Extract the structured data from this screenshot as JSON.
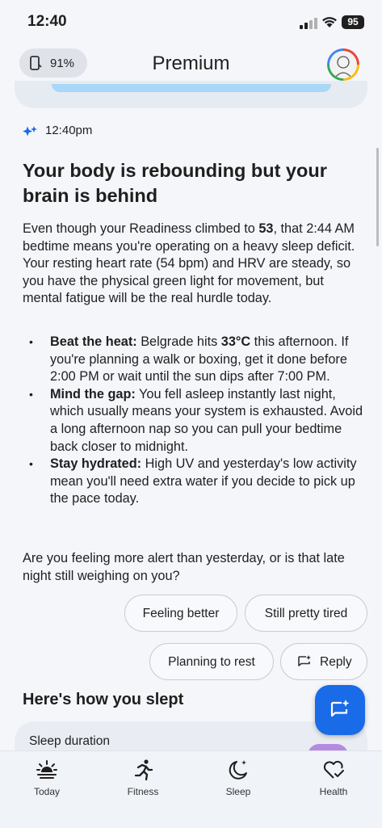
{
  "status_bar": {
    "time": "12:40",
    "battery": "95"
  },
  "header": {
    "battery_pct": "91%",
    "title": "Premium"
  },
  "message": {
    "time": "12:40pm",
    "headline": "Your body is rebounding but your brain is behind",
    "para_part1": "Even though your Readiness climbed to ",
    "readiness": "53",
    "para_part2": ", that 2:44 AM bedtime means you're operating on a heavy sleep deficit. Your resting heart rate (54 bpm) and HRV are steady, so you have the physical green light for movement, but mental fatigue will be the real hurdle today.",
    "bullets": [
      {
        "title": "Beat the heat:",
        "text_a": " Belgrade hits ",
        "highlight": "33°C",
        "text_b": " this afternoon. If you're planning a walk or boxing, get it done before 2:00 PM or wait until the sun dips after 7:00 PM."
      },
      {
        "title": "Mind the gap:",
        "text_a": " You fell asleep instantly last night, which usually means your system is exhausted. Avoid a long afternoon nap so you can pull your bedtime back closer to midnight."
      },
      {
        "title": "Stay hydrated:",
        "text_a": " High UV and yesterday's low activity mean you'll need extra water if you decide to pick up the pace today."
      }
    ],
    "question": "Are you feeling more alert than yesterday, or is that late night still weighing on you?"
  },
  "chips": [
    "Feeling better",
    "Still pretty tired",
    "Planning to rest",
    "Reply"
  ],
  "section": {
    "title": "Here's how you slept",
    "card_label": "Sleep duration"
  },
  "nav": [
    "Today",
    "Fitness",
    "Sleep",
    "Health"
  ],
  "colors": {
    "accent": "#1a6be8",
    "sleep_accent": "#b48be0"
  }
}
